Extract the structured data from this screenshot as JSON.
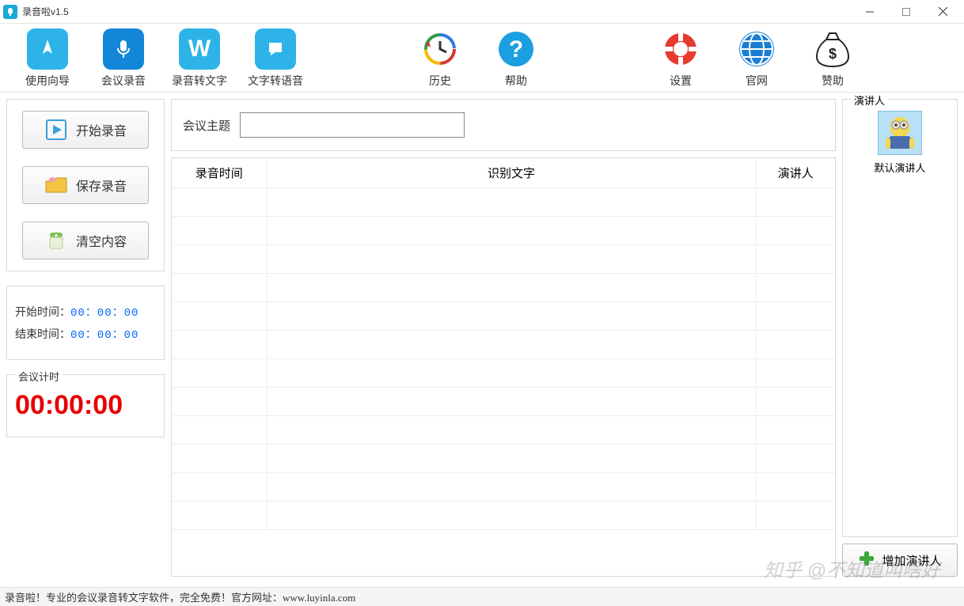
{
  "window": {
    "title": "录音啦v1.5"
  },
  "toolbar": {
    "guide": "使用向导",
    "meeting": "会议录音",
    "rec2text": "录音转文字",
    "text2speech": "文字转语音",
    "history": "历史",
    "help": "帮助",
    "settings": "设置",
    "website": "官网",
    "donate": "赞助"
  },
  "actions": {
    "start": "开始录音",
    "save": "保存录音",
    "clear": "清空内容"
  },
  "times": {
    "start_label": "开始时间：",
    "start_value": "00：00：00",
    "end_label": "结束时间：",
    "end_value": "00：00：00"
  },
  "timer": {
    "label": "会议计时",
    "value": "00:00:00"
  },
  "topic": {
    "label": "会议主题",
    "value": ""
  },
  "table": {
    "col_time": "录音时间",
    "col_text": "识别文字",
    "col_speaker": "演讲人"
  },
  "speakers": {
    "panel_label": "演讲人",
    "items": [
      {
        "name": "默认演讲人"
      }
    ],
    "add_label": "增加演讲人"
  },
  "statusbar": "录音啦！专业的会议录音转文字软件，完全免费！官方网址：www.luyinla.com",
  "watermark": "知乎 @不知道叫啥好"
}
